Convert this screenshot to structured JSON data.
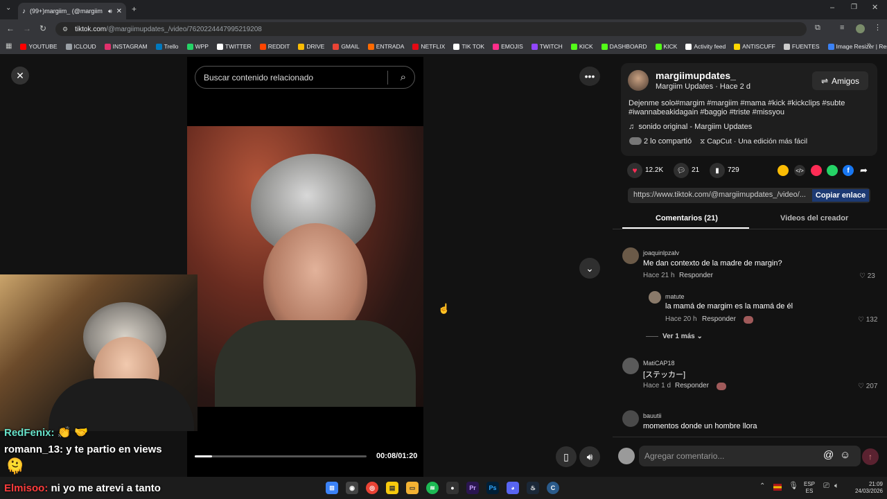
{
  "browser": {
    "tab_title": "(99+)margiim_ (@margiim",
    "url_host": "tiktok.com",
    "url_path": "/@margiimupdates_/video/7620224447995219208"
  },
  "bookmarks": [
    "YOUTUBE",
    "ICLOUD",
    "INSTAGRAM",
    "Trello",
    "WPP",
    "TWITTER",
    "REDDIT",
    "DRIVE",
    "GMAIL",
    "ENTRADA",
    "NETFLIX",
    "TIK TOK",
    "EMOJIS",
    "TWITCH",
    "KICK",
    "DASHBOARD",
    "KICK",
    "Activity feed",
    "ANTISCUFF",
    "FUENTES",
    "Image Resizer | Resi..."
  ],
  "bookmark_colors": [
    "#ff0000",
    "#9aa0a6",
    "#e1306c",
    "#0079bf",
    "#25d366",
    "#ffffff",
    "#ff4500",
    "#fbbc04",
    "#ea4335",
    "#ff6a00",
    "#e50914",
    "#ffffff",
    "#ff2d8a",
    "#9146ff",
    "#53fc18",
    "#53fc18",
    "#53fc18",
    "#ffffff",
    "#ffd700",
    "#cccccc",
    "#3b82f6"
  ],
  "search": {
    "placeholder": "Buscar contenido relacionado"
  },
  "player": {
    "current_time": "00:08/01:20",
    "progress": 0.1
  },
  "author": {
    "username": "margiimupdates_",
    "display": "Margiim Updates · Hace 2 d",
    "friends_button": "Amigos"
  },
  "description": "Dejenme solo#margim #margiim #mama #kick #kickclips #subte #iwannabeakidagain #baggio #triste #missyou",
  "sound": "sonido original - Margiim Updates",
  "shared": "2 lo compartió",
  "capcut": "CapCut · Una edición más fácil",
  "stats": {
    "likes": "12.2K",
    "comments": "21",
    "saves": "729"
  },
  "share_link": {
    "url": "https://www.tiktok.com/@margiimupdates_/video/...",
    "copy_label": "Copiar enlace"
  },
  "tabs": {
    "comments": "Comentarios (21)",
    "creator_videos": "Videos del creador"
  },
  "comments": [
    {
      "user": "joaquinlpzalv",
      "text": "Me dan contexto de la madre de margin?",
      "time": "Hace 21 h",
      "reply": "Responder",
      "likes": "23"
    },
    {
      "user": "matute",
      "text": "la mamá de margim es la mamá de él",
      "time": "Hace 20 h",
      "reply": "Responder",
      "likes": "132"
    },
    {
      "user": "MatiCAP18",
      "text": "[ステッカー]",
      "time": "Hace 1 d",
      "reply": "Responder",
      "likes": "207"
    },
    {
      "user": "bauutii",
      "text": "momentos donde un hombre llora"
    }
  ],
  "view_more": "Ver 1 más",
  "comment_input": {
    "placeholder": "Agregar comentario..."
  },
  "chat": [
    {
      "user": "RedFenix:",
      "text": "",
      "color": "#66e0c8"
    },
    {
      "user": "romann_13:",
      "text": "y te partio en views",
      "color": "#ffffff"
    },
    {
      "user": "Elmisoo:",
      "text": "ni yo me atrevi a tanto",
      "color": "#ff3b3b"
    }
  ],
  "taskbar": {
    "lang_top": "ESP",
    "lang_bottom": "ES",
    "time": "21:09",
    "date": "24/03/2026"
  }
}
